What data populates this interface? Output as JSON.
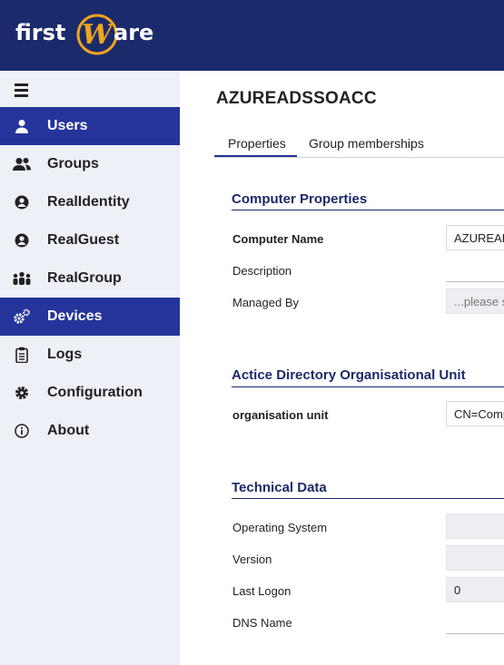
{
  "brand": {
    "logo_text": "firstWare",
    "colors": {
      "header": "#1b2a6b",
      "accent": "#f0a41d",
      "active_nav": "#25349a"
    }
  },
  "sidebar": {
    "menu_icon": "hamburger-icon",
    "items": [
      {
        "label": "Users",
        "icon": "user-icon",
        "active": true
      },
      {
        "label": "Groups",
        "icon": "users-icon",
        "active": false
      },
      {
        "label": "RealIdentity",
        "icon": "user-circle-icon",
        "active": false
      },
      {
        "label": "RealGuest",
        "icon": "user-circle-icon",
        "active": false
      },
      {
        "label": "RealGroup",
        "icon": "people-group-icon",
        "active": false
      },
      {
        "label": "Devices",
        "icon": "gears-icon",
        "active": true
      },
      {
        "label": "Logs",
        "icon": "clipboard-icon",
        "active": false
      },
      {
        "label": "Configuration",
        "icon": "gear-icon",
        "active": false
      },
      {
        "label": "About",
        "icon": "info-icon",
        "active": false
      }
    ]
  },
  "main": {
    "title": "AZUREADSSOACC",
    "tabs": [
      {
        "label": "Properties",
        "active": true
      },
      {
        "label": "Group memberships",
        "active": false
      }
    ],
    "sections": {
      "computer_properties": {
        "title": "Computer Properties",
        "computer_name": {
          "label": "Computer Name",
          "value": "AZUREADSSOACC"
        },
        "description": {
          "label": "Description",
          "value": ""
        },
        "managed_by": {
          "label": "Managed By",
          "placeholder": "...please select"
        }
      },
      "ad_ou": {
        "title": "Actice Directory Organisational Unit",
        "organisation_unit": {
          "label": "organisation unit",
          "value": "CN=Computers"
        }
      },
      "technical": {
        "title": "Technical Data",
        "operating_system": {
          "label": "Operating System",
          "value": ""
        },
        "version": {
          "label": "Version",
          "value": ""
        },
        "last_logon": {
          "label": "Last Logon",
          "value": "0"
        },
        "dns_name": {
          "label": "DNS Name",
          "value": ""
        }
      }
    }
  }
}
